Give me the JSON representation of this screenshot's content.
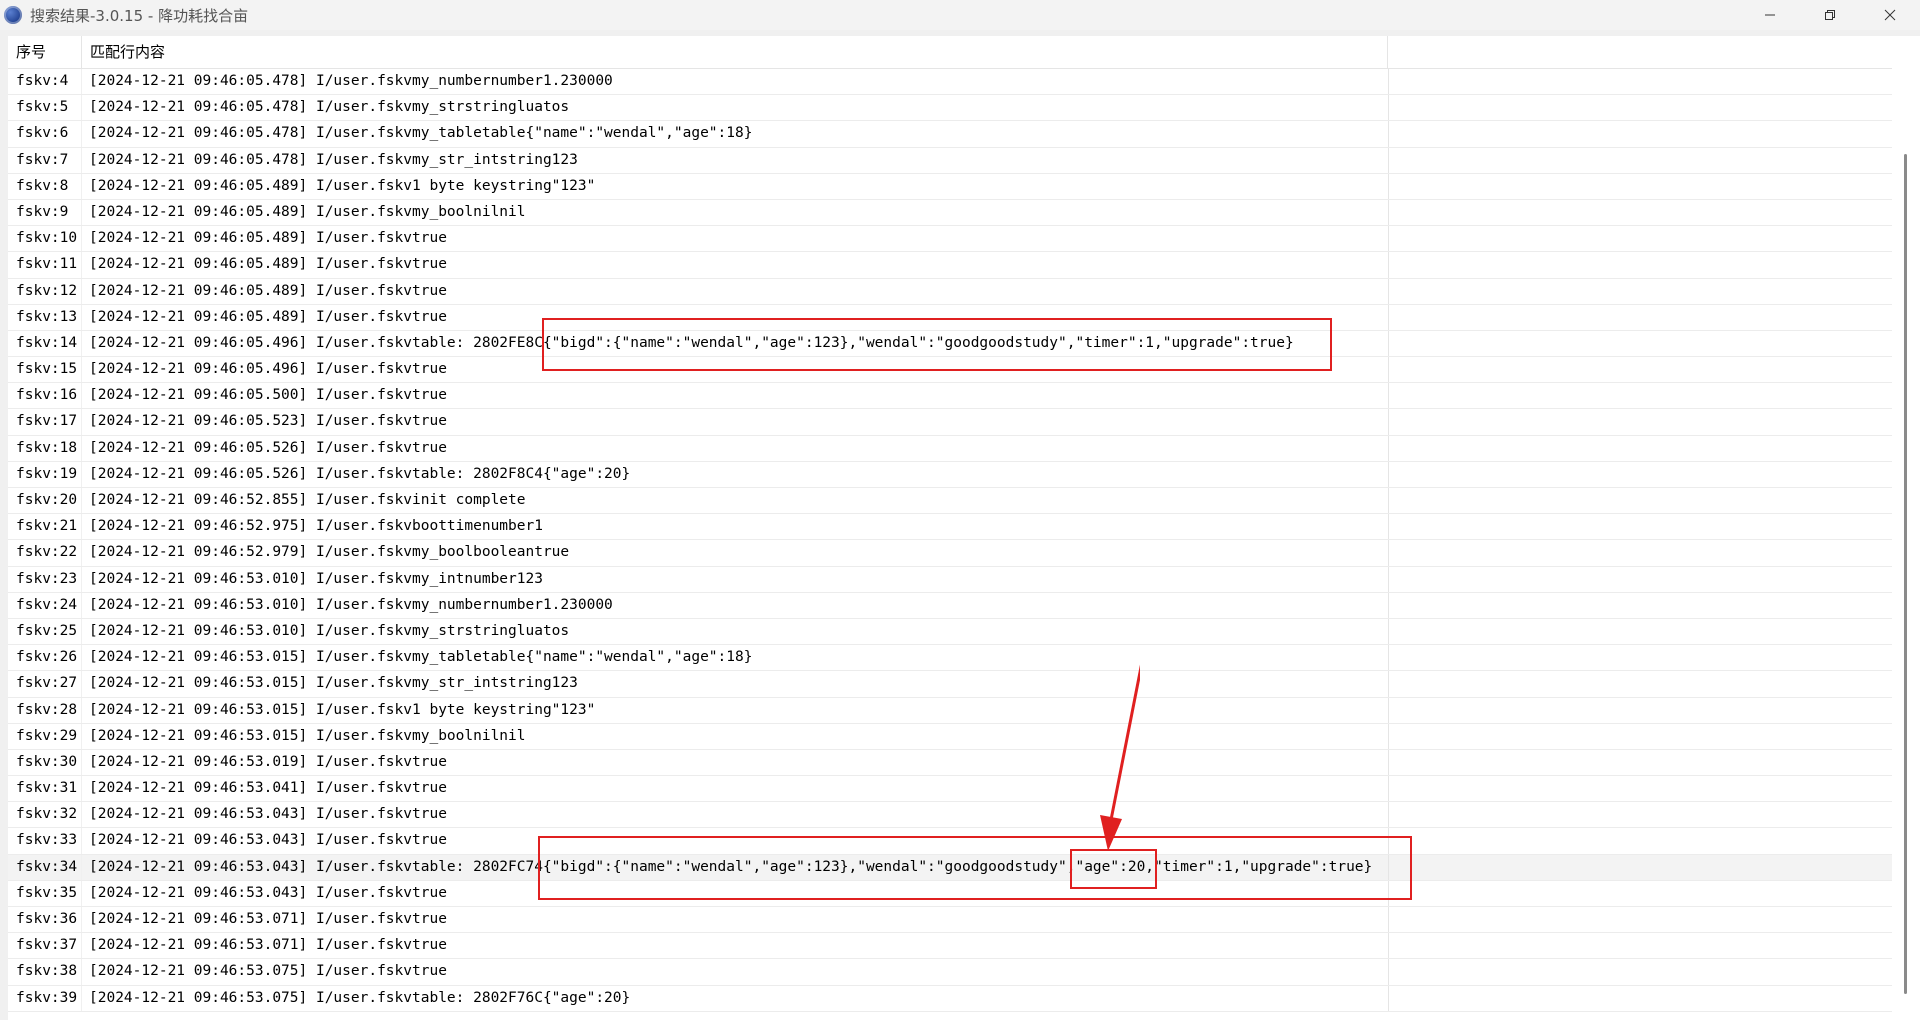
{
  "window": {
    "title": "搜索结果-3.0.15 - 降功耗找合亩"
  },
  "columns": {
    "seq": "序号",
    "content": "匹配行内容"
  },
  "rows": [
    {
      "seq": "fskv:4",
      "text": "[2024-12-21 09:46:05.478] I/user.fskvmy_numbernumber1.230000"
    },
    {
      "seq": "fskv:5",
      "text": "[2024-12-21 09:46:05.478] I/user.fskvmy_strstringluatos"
    },
    {
      "seq": "fskv:6",
      "text": "[2024-12-21 09:46:05.478] I/user.fskvmy_tabletable{\"name\":\"wendal\",\"age\":18}"
    },
    {
      "seq": "fskv:7",
      "text": "[2024-12-21 09:46:05.478] I/user.fskvmy_str_intstring123"
    },
    {
      "seq": "fskv:8",
      "text": "[2024-12-21 09:46:05.489] I/user.fskv1 byte keystring\"123\""
    },
    {
      "seq": "fskv:9",
      "text": "[2024-12-21 09:46:05.489] I/user.fskvmy_boolnilnil"
    },
    {
      "seq": "fskv:10",
      "text": "[2024-12-21 09:46:05.489] I/user.fskvtrue"
    },
    {
      "seq": "fskv:11",
      "text": "[2024-12-21 09:46:05.489] I/user.fskvtrue"
    },
    {
      "seq": "fskv:12",
      "text": "[2024-12-21 09:46:05.489] I/user.fskvtrue"
    },
    {
      "seq": "fskv:13",
      "text": "[2024-12-21 09:46:05.489] I/user.fskvtrue"
    },
    {
      "seq": "fskv:14",
      "text": "[2024-12-21 09:46:05.496] I/user.fskvtable: 2802FE8C{\"bigd\":{\"name\":\"wendal\",\"age\":123},\"wendal\":\"goodgoodstudy\",\"timer\":1,\"upgrade\":true}"
    },
    {
      "seq": "fskv:15",
      "text": "[2024-12-21 09:46:05.496] I/user.fskvtrue"
    },
    {
      "seq": "fskv:16",
      "text": "[2024-12-21 09:46:05.500] I/user.fskvtrue"
    },
    {
      "seq": "fskv:17",
      "text": "[2024-12-21 09:46:05.523] I/user.fskvtrue"
    },
    {
      "seq": "fskv:18",
      "text": "[2024-12-21 09:46:05.526] I/user.fskvtrue"
    },
    {
      "seq": "fskv:19",
      "text": "[2024-12-21 09:46:05.526] I/user.fskvtable: 2802F8C4{\"age\":20}"
    },
    {
      "seq": "fskv:20",
      "text": "[2024-12-21 09:46:52.855] I/user.fskvinit complete"
    },
    {
      "seq": "fskv:21",
      "text": "[2024-12-21 09:46:52.975] I/user.fskvboottimenumber1"
    },
    {
      "seq": "fskv:22",
      "text": "[2024-12-21 09:46:52.979] I/user.fskvmy_boolbooleantrue"
    },
    {
      "seq": "fskv:23",
      "text": "[2024-12-21 09:46:53.010] I/user.fskvmy_intnumber123"
    },
    {
      "seq": "fskv:24",
      "text": "[2024-12-21 09:46:53.010] I/user.fskvmy_numbernumber1.230000"
    },
    {
      "seq": "fskv:25",
      "text": "[2024-12-21 09:46:53.010] I/user.fskvmy_strstringluatos"
    },
    {
      "seq": "fskv:26",
      "text": "[2024-12-21 09:46:53.015] I/user.fskvmy_tabletable{\"name\":\"wendal\",\"age\":18}"
    },
    {
      "seq": "fskv:27",
      "text": "[2024-12-21 09:46:53.015] I/user.fskvmy_str_intstring123"
    },
    {
      "seq": "fskv:28",
      "text": "[2024-12-21 09:46:53.015] I/user.fskv1 byte keystring\"123\""
    },
    {
      "seq": "fskv:29",
      "text": "[2024-12-21 09:46:53.015] I/user.fskvmy_boolnilnil"
    },
    {
      "seq": "fskv:30",
      "text": "[2024-12-21 09:46:53.019] I/user.fskvtrue"
    },
    {
      "seq": "fskv:31",
      "text": "[2024-12-21 09:46:53.041] I/user.fskvtrue"
    },
    {
      "seq": "fskv:32",
      "text": "[2024-12-21 09:46:53.043] I/user.fskvtrue"
    },
    {
      "seq": "fskv:33",
      "text": "[2024-12-21 09:46:53.043] I/user.fskvtrue"
    },
    {
      "seq": "fskv:34",
      "text": "[2024-12-21 09:46:53.043] I/user.fskvtable: 2802FC74{\"bigd\":{\"name\":\"wendal\",\"age\":123},\"wendal\":\"goodgoodstudy\",\"age\":20,\"timer\":1,\"upgrade\":true}",
      "selected": true
    },
    {
      "seq": "fskv:35",
      "text": "[2024-12-21 09:46:53.043] I/user.fskvtrue"
    },
    {
      "seq": "fskv:36",
      "text": "[2024-12-21 09:46:53.071] I/user.fskvtrue"
    },
    {
      "seq": "fskv:37",
      "text": "[2024-12-21 09:46:53.071] I/user.fskvtrue"
    },
    {
      "seq": "fskv:38",
      "text": "[2024-12-21 09:46:53.075] I/user.fskvtrue"
    },
    {
      "seq": "fskv:39",
      "text": "[2024-12-21 09:46:53.075] I/user.fskvtable: 2802F76C{\"age\":20}"
    }
  ],
  "icons": {
    "app": "app-logo-icon",
    "minimize": "minimize-icon",
    "restore": "restore-icon",
    "close": "close-icon"
  },
  "colors": {
    "annotation": "#e02020",
    "selected_row": "#f3f3f3"
  }
}
